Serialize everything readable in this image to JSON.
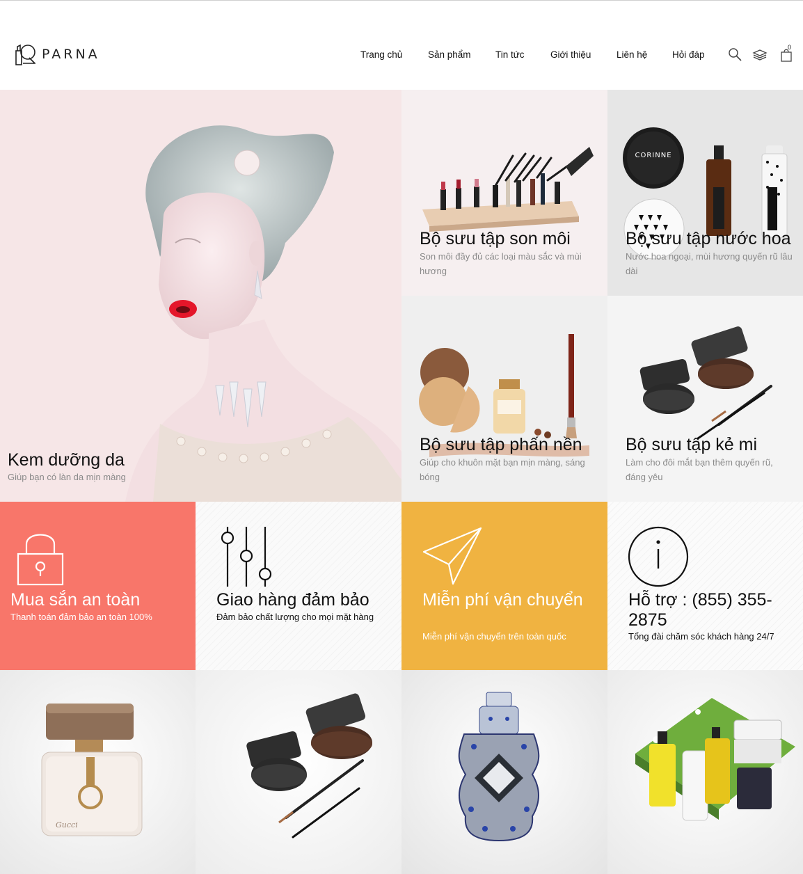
{
  "brand": {
    "name": "PARNA"
  },
  "nav": {
    "items": [
      "Trang chủ",
      "Sản phẩm",
      "Tin tức",
      "Giới thiệu",
      "Liên hệ",
      "Hỏi đáp"
    ]
  },
  "header_icons": {
    "search": "search-icon",
    "layers": "layers-icon",
    "cart": "cart-icon",
    "cart_count": "0"
  },
  "hero": {
    "title": "Kem dưỡng da",
    "desc": "Giúp bạn có làn da mịn màng"
  },
  "collections": [
    {
      "title": "Bộ sưu tập son môi",
      "desc": "Son môi đầy đủ các loại màu sắc và mùi hương"
    },
    {
      "title": "Bộ sưu tập nước hoa",
      "desc": "Nước hoa ngoại, mùi hương quyến rũ lâu dài"
    },
    {
      "title": "Bộ sưu tập phấn nền",
      "desc": "Giúp cho khuôn mặt bạn mịn màng, sáng bóng"
    },
    {
      "title": "Bộ sưu tập kẻ mi",
      "desc": "Làm cho đôi mắt bạn thêm quyến rũ, đáng yêu"
    }
  ],
  "features": [
    {
      "icon": "lock-icon",
      "title": "Mua sắn an toàn",
      "desc": "Thanh toán đảm bảo an toàn 100%",
      "bg": "#f8766a",
      "color": "#ffffff"
    },
    {
      "icon": "sliders-icon",
      "title": "Giao hàng đảm bảo",
      "desc": "Đảm bảo chất lượng cho mọi mặt hàng",
      "bg": "#fafafa",
      "color": "#111111"
    },
    {
      "icon": "paper-plane-icon",
      "title": "Miễn phí vận chuyển",
      "desc": "Miễn phí vận chuyển trên toàn quốc",
      "bg": "#f0b341",
      "color": "#ffffff"
    },
    {
      "icon": "info-icon",
      "title": "Hỗ trợ : (855) 355-2875",
      "desc": "Tổng đài chăm sóc khách hàng 24/7",
      "bg": "#fafafa",
      "color": "#111111"
    }
  ],
  "products": [
    {
      "icon": "perfume-bottle-icon"
    },
    {
      "icon": "eyeliner-gel-icon"
    },
    {
      "icon": "ornate-perfume-icon"
    },
    {
      "icon": "skincare-set-icon"
    }
  ]
}
